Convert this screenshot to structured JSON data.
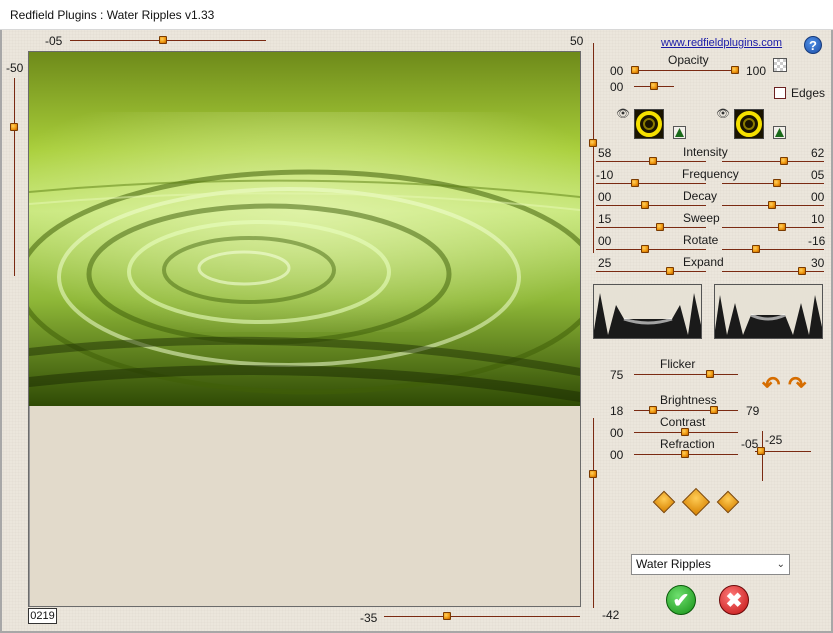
{
  "window": {
    "title": "Redfield Plugins : Water Ripples v1.33"
  },
  "link": {
    "text": "www.redfieldplugins.com"
  },
  "preview": {
    "top_slider": {
      "left_value": "-05",
      "right_value": "50"
    },
    "left_slider": {
      "value": "-50"
    },
    "bottom_slider": {
      "value": "-35"
    },
    "right_slider": {
      "bottom_value": "-42"
    },
    "frame_number": "0219"
  },
  "opacity": {
    "label": "Opacity",
    "left_value": "00",
    "right_value": "100",
    "second_value": "00"
  },
  "edges": {
    "label": "Edges"
  },
  "params": [
    {
      "label": "Intensity",
      "left": "58",
      "right": "62"
    },
    {
      "label": "Frequency",
      "left": "-10",
      "right": "05"
    },
    {
      "label": "Decay",
      "left": "00",
      "right": "00"
    },
    {
      "label": "Sweep",
      "left": "15",
      "right": "10"
    },
    {
      "label": "Rotate",
      "left": "00",
      "right": "-16"
    },
    {
      "label": "Expand",
      "left": "25",
      "right": "30"
    }
  ],
  "lighting": {
    "flicker": {
      "label": "Flicker",
      "value": "75"
    },
    "brightness": {
      "label": "Brightness",
      "left": "18",
      "right": "79"
    },
    "contrast": {
      "label": "Contrast",
      "value": "00"
    },
    "refraction": {
      "label": "Refraction",
      "value": "00"
    },
    "xy": {
      "x": "-05",
      "y": "-25"
    }
  },
  "preset": {
    "selected": "Water Ripples"
  },
  "colors": {
    "accent": "#f09a10",
    "track": "#7a2a12",
    "ok": "#159015",
    "cancel": "#c01010"
  }
}
